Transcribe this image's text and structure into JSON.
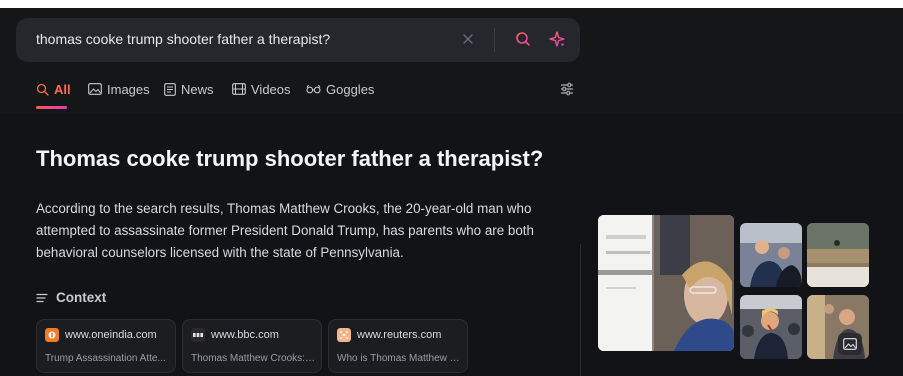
{
  "search": {
    "query": "thomas cooke trump shooter father a therapist?"
  },
  "tabs": [
    {
      "label": "All",
      "active": true
    },
    {
      "label": "Images"
    },
    {
      "label": "News"
    },
    {
      "label": "Videos"
    },
    {
      "label": "Goggles"
    }
  ],
  "answer": {
    "title": "Thomas cooke trump shooter father a therapist?",
    "body": "According to the search results, Thomas Matthew Crooks, the 20-year-old man who attempted to assassinate former President Donald Trump, has parents who are both behavioral counselors licensed with the state of Pennsylvania."
  },
  "context": {
    "heading": "Context",
    "sources": [
      {
        "domain": "www.oneindia.com",
        "title": "Trump Assassination Atte...",
        "favicon_color": "#f07c2a"
      },
      {
        "domain": "www.bbc.com",
        "title": "Thomas Matthew Crooks: ...",
        "favicon_color": "#2a2a2e"
      },
      {
        "domain": "www.reuters.com",
        "title": "Who is Thomas Matthew C...",
        "favicon_color": "#f5b58a"
      }
    ]
  },
  "colors": {
    "accent": "#ff6a4d",
    "background": "#121316",
    "searchbox": "#25272c"
  }
}
